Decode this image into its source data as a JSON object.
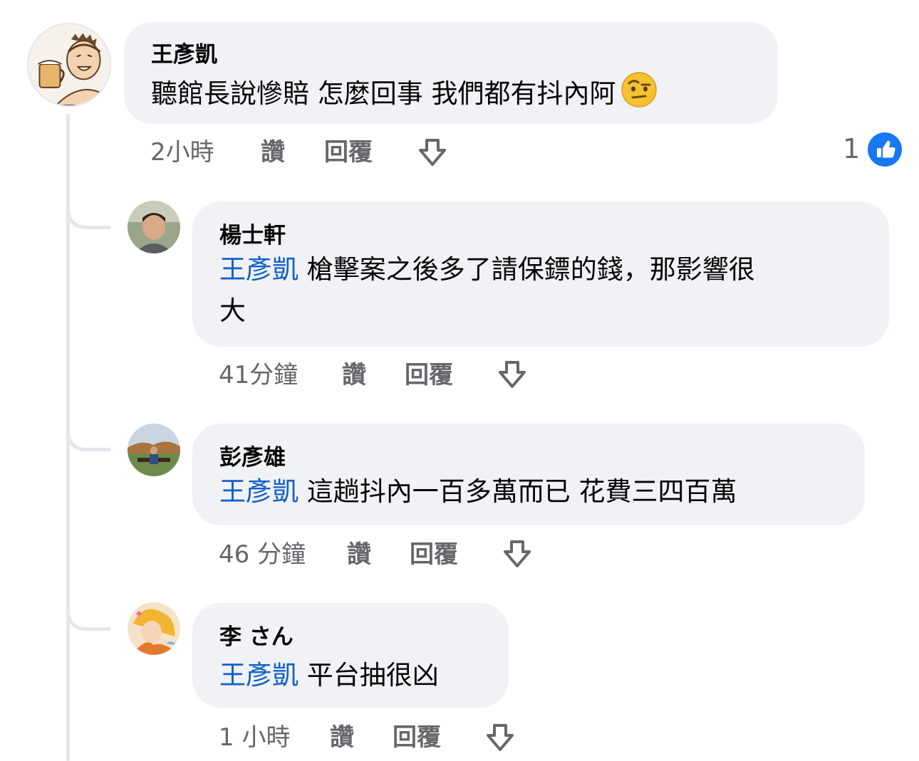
{
  "comment": {
    "author": "王彥凱",
    "text": "聽館長說慘賠 怎麼回事 我們都有抖內阿",
    "emoji": "raised-eyebrow-emoji",
    "time": "2小時",
    "like_label": "讚",
    "reply_label": "回覆",
    "reaction_count": "1"
  },
  "replies": [
    {
      "author": "楊士軒",
      "mention": "王彥凱",
      "text_line1": " 槍擊案之後多了請保鏢的錢，那影響很",
      "text_line2": "大",
      "time": "41分鐘",
      "like_label": "讚",
      "reply_label": "回覆"
    },
    {
      "author": "彭彥雄",
      "mention": "王彥凱",
      "text": " 這趟抖內一百多萬而已 花費三四百萬",
      "time": "46 分鐘",
      "like_label": "讚",
      "reply_label": "回覆"
    },
    {
      "author": "李 さん",
      "mention": "王彥凱",
      "text": " 平台抽很凶",
      "time": "1 小時",
      "like_label": "讚",
      "reply_label": "回覆"
    }
  ],
  "colors": {
    "bubble": "#f0f2f5",
    "mention": "#1060c9",
    "meta": "#65676b",
    "like_badge": "#1877f2",
    "thread_line": "#e4e6eb"
  }
}
